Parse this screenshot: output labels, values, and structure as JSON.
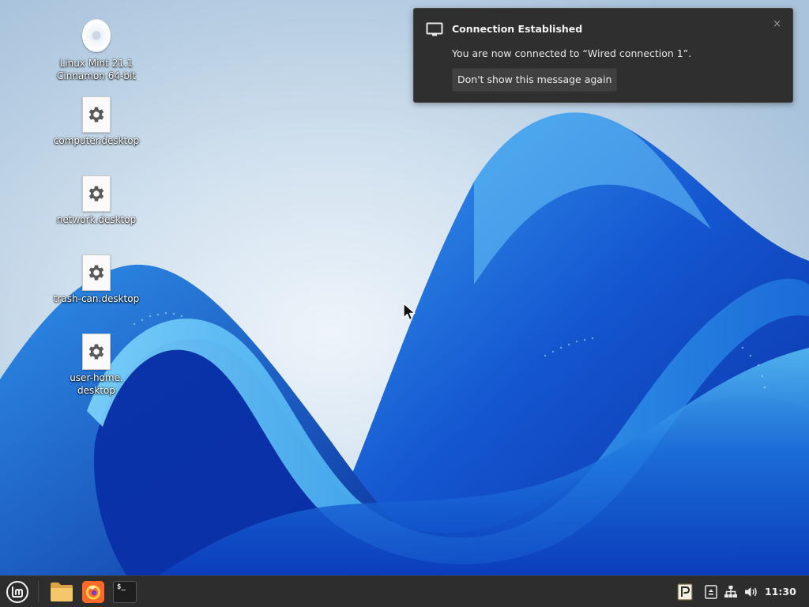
{
  "desktop": {
    "icons": [
      {
        "label": "Linux Mint 21.1\nCinnamon 64-bit",
        "icon": "disc-icon"
      },
      {
        "label": "computer.desktop",
        "icon": "gear-icon"
      },
      {
        "label": "network.desktop",
        "icon": "gear-icon"
      },
      {
        "label": "trash-can.desktop",
        "icon": "gear-icon"
      },
      {
        "label": "user-home.\ndesktop",
        "icon": "gear-icon"
      }
    ]
  },
  "notification": {
    "title": "Connection Established",
    "body": "You are now connected to “Wired connection 1”.",
    "button": "Don't show this message again",
    "close": "×",
    "icon": "monitor-icon"
  },
  "taskbar": {
    "launchers": [
      {
        "name": "menu-button",
        "icon": "mint-logo-icon"
      },
      {
        "name": "files-launcher",
        "icon": "folder-icon"
      },
      {
        "name": "firefox-launcher",
        "icon": "firefox-icon"
      },
      {
        "name": "terminal-launcher",
        "icon": "terminal-icon",
        "glyph": "$_"
      }
    ],
    "tray": {
      "icons": [
        "pidgin-icon",
        "update-manager-icon",
        "network-icon",
        "volume-icon"
      ]
    },
    "clock": "11:30"
  },
  "colors": {
    "panel": "#2d2d2d",
    "notification_bg": "#2f2f2f",
    "accent_blue": "#1f6fd6",
    "mint_green": "#8fbf3f"
  }
}
